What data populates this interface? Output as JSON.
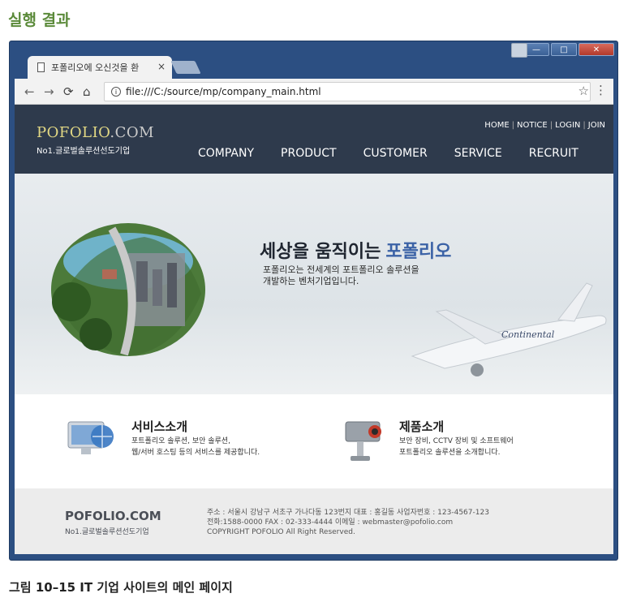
{
  "heading": "실행 결과",
  "browser": {
    "tab_title": "포폴리오에 오신것을 환",
    "tab_close": "×",
    "url": "file:///C:/source/mp/company_main.html"
  },
  "site": {
    "logo": "POFOLIO",
    "logo_suffix": ".COM",
    "logo_sub": "No1.글로벌솔루션선도기업",
    "util_links": [
      "HOME",
      "NOTICE",
      "LOGIN",
      "JOIN"
    ],
    "gnb": [
      "COMPANY",
      "PRODUCT",
      "CUSTOMER",
      "SERVICE",
      "RECRUIT"
    ],
    "hero_title": "세상을 움직이는",
    "hero_title_accent": "포폴리오",
    "hero_desc_line1": "포폴리오는 전세계의 포트폴리오 솔루션을",
    "hero_desc_line2": "개발하는 벤처기업입니다.",
    "plane_text": "Continental",
    "service1_title": "서비스소개",
    "service1_desc_line1": "포트폴리오 솔루션, 보안 솔루션,",
    "service1_desc_line2": "웹/서버 호스팅 등의 서비스를 제공합니다.",
    "service2_title": "제품소개",
    "service2_desc_line1": "보안 장비, CCTV 장비 및 소프트웨어",
    "service2_desc_line2": "포트폴리오 솔루션을 소개합니다.",
    "footer_logo": "POFOLIO.COM",
    "footer_sub": "No1.글로벌솔루션선도기업",
    "footer_line1": "주소 : 서울시 강남구 서초구 가나다동 123번지     대표 : 홍길동  사업자번호 : 123-4567-123",
    "footer_line2": "전화:1588-0000     FAX : 02-333-4444   이메일 : webmaster@pofolio.com",
    "footer_line3": "COPYRIGHT POFOLIO All Right Reserved."
  },
  "caption": "그림 10–15 IT 기업 사이트의 메인 페이지",
  "colors": {
    "heading": "#5b8a3a",
    "window_frame": "#2c4f82",
    "site_header": "#2e3a4c",
    "logo": "#e2d884",
    "hero_accent": "#3b62a6",
    "footer": "#ececec"
  }
}
